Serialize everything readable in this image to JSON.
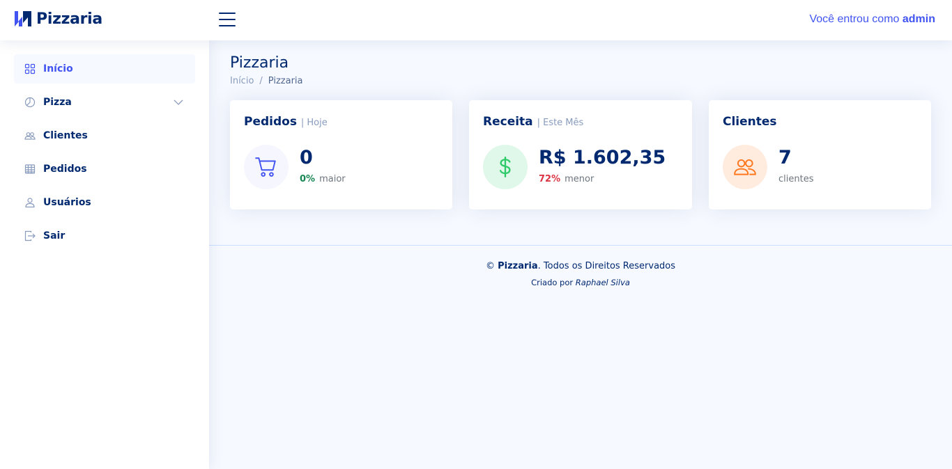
{
  "header": {
    "brand": "Pizzaria",
    "user_prefix": "Você entrou como ",
    "user_name": "admin"
  },
  "sidebar": {
    "items": [
      {
        "label": "Início",
        "icon": "grid-icon",
        "active": true
      },
      {
        "label": "Pizza",
        "icon": "pie-chart-icon",
        "active": false,
        "has_submenu": true
      },
      {
        "label": "Clientes",
        "icon": "people-icon",
        "active": false
      },
      {
        "label": "Pedidos",
        "icon": "table-icon",
        "active": false
      },
      {
        "label": "Usuários",
        "icon": "person-icon",
        "active": false
      },
      {
        "label": "Sair",
        "icon": "logout-icon",
        "active": false
      }
    ]
  },
  "main": {
    "page_title": "Pizzaria",
    "breadcrumb": {
      "home": "Início",
      "separator": "/",
      "current": "Pizzaria"
    },
    "cards": {
      "orders": {
        "title": "Pedidos",
        "subtitle": "| Hoje",
        "value": "0",
        "pct": "0%",
        "pct_label": "maior",
        "icon": "cart-icon",
        "icon_bg": "#f6f6fe",
        "icon_color": "#4154f1"
      },
      "revenue": {
        "title": "Receita",
        "subtitle": "| Este Mês",
        "value": "R$ 1.602,35",
        "pct": "72%",
        "pct_label": "menor",
        "icon": "dollar-icon",
        "icon_bg": "#e0f8e9",
        "icon_color": "#2eca6a"
      },
      "customers": {
        "title": "Clientes",
        "value": "7",
        "label": "clientes",
        "icon": "people-icon",
        "icon_bg": "#ffecdf",
        "icon_color": "#ff771d"
      }
    }
  },
  "footer": {
    "copyright_symbol": "©",
    "brand": "Pizzaria",
    "rights": ". Todos os Direitos Reservados",
    "created_by": "Criado por ",
    "author": "Raphael Silva"
  },
  "colors": {
    "accent": "#4154f1",
    "navy": "#012970",
    "background": "#f6f9ff",
    "success": "#198754",
    "danger": "#dc3545"
  }
}
